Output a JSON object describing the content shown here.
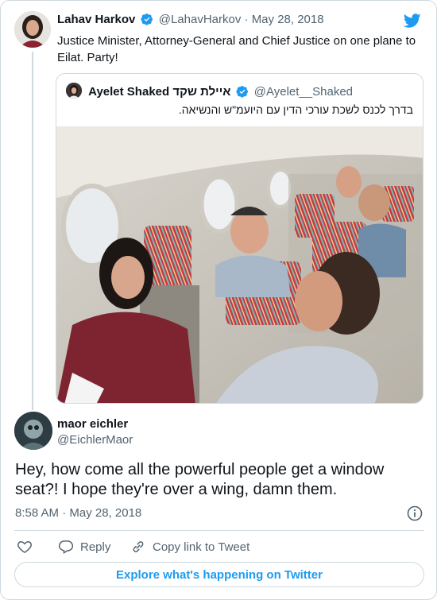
{
  "tweet": {
    "author_name": "Lahav Harkov",
    "author_handle": "@LahavHarkov",
    "separator": "·",
    "date": "May 28, 2018",
    "text": "Justice Minister, Attorney-General and Chief Justice on one plane to Eilat. Party!"
  },
  "quoted_tweet": {
    "author_name": "איילת שקד Ayelet Shaked",
    "author_handle": "@Ayelet__Shaked",
    "text": "בדרך לכנס לשכת עורכי הדין עם היועמ\"ש והנשיאה."
  },
  "reply_tweet": {
    "author_name": "maor eichler",
    "author_handle": "@EichlerMaor",
    "text": "Hey, how come all the powerful people get a window seat?! I hope they're over a wing, damn them.",
    "timestamp": "8:58 AM · May 28, 2018"
  },
  "actions": {
    "reply_label": "Reply",
    "copy_label": "Copy link to Tweet"
  },
  "explore_label": "Explore what's happening on Twitter",
  "colors": {
    "twitter_blue": "#1d9bf0",
    "muted_text": "#536471",
    "border": "#cfd9de",
    "like_red": "#f91880"
  },
  "icons": [
    "twitter-bird-icon",
    "verified-badge-icon",
    "info-icon",
    "heart-icon",
    "reply-bubble-icon",
    "link-icon"
  ]
}
